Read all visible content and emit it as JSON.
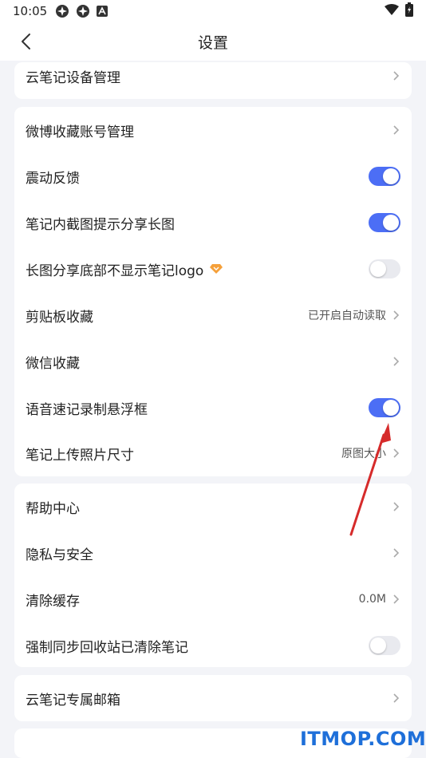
{
  "status_bar": {
    "time": "10:05"
  },
  "nav": {
    "title": "设置"
  },
  "sections": {
    "s0": {
      "items": [
        {
          "label": "云笔记设备管理"
        }
      ]
    },
    "s1": {
      "items": [
        {
          "label": "微博收藏账号管理"
        },
        {
          "label": "震动反馈",
          "toggle": true
        },
        {
          "label": "笔记内截图提示分享长图",
          "toggle": true
        },
        {
          "label": "长图分享底部不显示笔记logo",
          "toggle": false
        },
        {
          "label": "剪贴板收藏",
          "value": "已开启自动读取"
        },
        {
          "label": "微信收藏"
        },
        {
          "label": "语音速记录制悬浮框",
          "toggle": true
        },
        {
          "label": "笔记上传照片尺寸",
          "value": "原图大小"
        }
      ]
    },
    "s2": {
      "items": [
        {
          "label": "帮助中心"
        },
        {
          "label": "隐私与安全"
        },
        {
          "label": "清除缓存",
          "value": "0.0M"
        },
        {
          "label": "强制同步回收站已清除笔记",
          "toggle": false
        }
      ]
    },
    "s3": {
      "items": [
        {
          "label": "云笔记专属邮箱"
        }
      ]
    }
  },
  "icons": {
    "back": "chevron-left-icon",
    "chevron": "chevron-right-icon",
    "vip": "diamond-icon"
  },
  "colors": {
    "accent": "#4c6ef5",
    "vip_badge": "#f5a03a",
    "annotation_arrow": "#d62b2b",
    "watermark": "#1e6fd9"
  },
  "watermark": {
    "text": "ITMOP.COM"
  }
}
